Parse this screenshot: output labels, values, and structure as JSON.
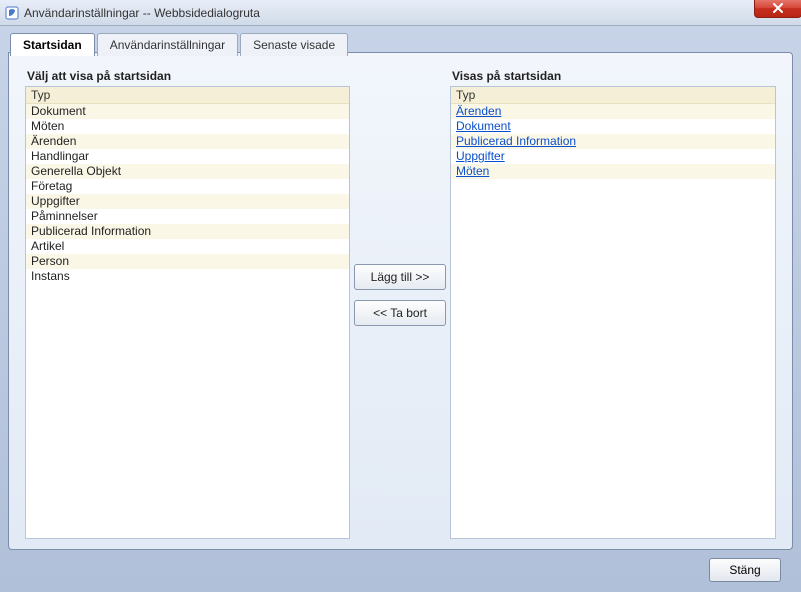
{
  "window": {
    "title": "Användarinställningar -- Webbsidedialogruta"
  },
  "tabs": [
    {
      "label": "Startsidan",
      "active": true
    },
    {
      "label": "Användarinställningar",
      "active": false
    },
    {
      "label": "Senaste visade",
      "active": false
    }
  ],
  "left": {
    "heading": "Välj att visa på startsidan",
    "column_header": "Typ",
    "items": [
      "Dokument",
      "Möten",
      "Ärenden",
      "Handlingar",
      "Generella Objekt",
      "Företag",
      "Uppgifter",
      "Påminnelser",
      "Publicerad Information",
      "Artikel",
      "Person",
      "Instans"
    ]
  },
  "right": {
    "heading": "Visas på startsidan",
    "column_header": "Typ",
    "items": [
      "Ärenden",
      "Dokument",
      "Publicerad Information",
      "Uppgifter",
      "Möten"
    ]
  },
  "buttons": {
    "add": "Lägg till >>",
    "remove": "<< Ta bort",
    "close": "Stäng"
  }
}
